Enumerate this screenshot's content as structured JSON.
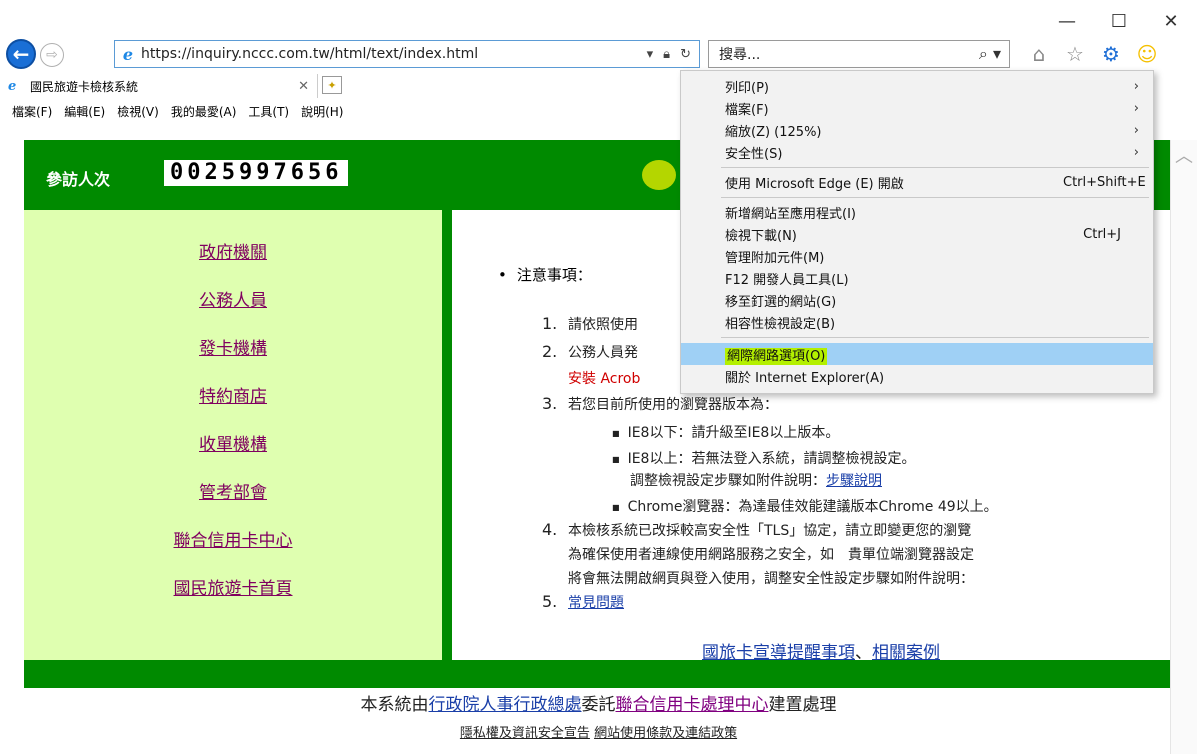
{
  "window": {
    "minimize": "—",
    "maximize": "☐",
    "close": "✕"
  },
  "address_bar": {
    "url": "https://inquiry.nccc.com.tw/html/text/index.html",
    "search_placeholder": "搜尋..."
  },
  "tab": {
    "title": "國民旅遊卡檢核系統"
  },
  "menu_bar": [
    "檔案(F)",
    "編輯(E)",
    "檢視(V)",
    "我的最愛(A)",
    "工具(T)",
    "說明(H)"
  ],
  "header": {
    "visitor_label": "參訪人次",
    "visitor_count": "0025997656"
  },
  "sidebar": {
    "items": [
      "政府機關",
      "公務人員",
      "發卡機構",
      "特約商店",
      "收單機構",
      "管考部會",
      "聯合信用卡中心",
      "國民旅遊卡首頁"
    ]
  },
  "notice": {
    "title": "注意事項：",
    "item1_num": "1.",
    "item1_text": "請依照使用",
    "item2_num": "2.",
    "item2_text": "公務人員発",
    "item2_cont": "安裝 Acrob",
    "item3_num": "3.",
    "item3_text": "若您目前所使用的瀏覽器版本為：",
    "bullet1": "IE8以下：請升級至IE8以上版本。",
    "bullet2": "IE8以上：若無法登入系統，請調整檢視設定。",
    "bullet2_sub": "調整檢視設定步驟如附件說明：",
    "bullet2_link": "步驟說明",
    "bullet3": "Chrome瀏覽器：為達最佳效能建議版本Chrome 49以上。",
    "item4_num": "4.",
    "item4_line1": "本檢核系統已改採較高安全性「TLS」協定，請立即變更您的瀏覽",
    "item4_line2": "為確保使用者連線使用網路服務之安全，如　貴單位端瀏覽器設定",
    "item4_line3": "將會無法開啟網頁與登入使用，調整安全性設定步驟如附件說明：",
    "item5_num": "5.",
    "item5_link": "常見問題",
    "bottom_link1": "國旅卡宣導提醒事項",
    "bottom_sep": "、",
    "bottom_link2": "相關案例"
  },
  "footer": {
    "line1_a": "本系統由",
    "line1_link1": "行政院人事行政總處",
    "line1_b": "委託",
    "line1_link2": "聯合信用卡處理中心",
    "line1_c": "建置處理",
    "line2_link1": "隱私權及資訊安全宣告",
    "line2_link2": "網站使用條款及連結政策"
  },
  "dropdown": {
    "items": [
      {
        "label": "列印(P)",
        "shortcut": "",
        "arrow": "›"
      },
      {
        "label": "檔案(F)",
        "shortcut": "",
        "arrow": "›"
      },
      {
        "label": "縮放(Z) (125%)",
        "shortcut": "",
        "arrow": "›"
      },
      {
        "label": "安全性(S)",
        "shortcut": "",
        "arrow": "›"
      },
      {
        "label": "使用 Microsoft Edge (E) 開啟",
        "shortcut": "Ctrl+Shift+E",
        "arrow": ""
      },
      {
        "label": "新增網站至應用程式(I)",
        "shortcut": "",
        "arrow": ""
      },
      {
        "label": "檢視下載(N)",
        "shortcut": "Ctrl+J",
        "arrow": ""
      },
      {
        "label": "管理附加元件(M)",
        "shortcut": "",
        "arrow": ""
      },
      {
        "label": "F12 開發人員工具(L)",
        "shortcut": "",
        "arrow": ""
      },
      {
        "label": "移至釘選的網站(G)",
        "shortcut": "",
        "arrow": ""
      },
      {
        "label": "相容性檢視設定(B)",
        "shortcut": "",
        "arrow": ""
      },
      {
        "label": "網際網路選項(O)",
        "shortcut": "",
        "arrow": ""
      },
      {
        "label": "關於 Internet Explorer(A)",
        "shortcut": "",
        "arrow": ""
      }
    ]
  },
  "colors": {
    "header_green": "#008a00",
    "sidebar_bg": "#dfffb0",
    "highlight": "#9fd0f5"
  }
}
